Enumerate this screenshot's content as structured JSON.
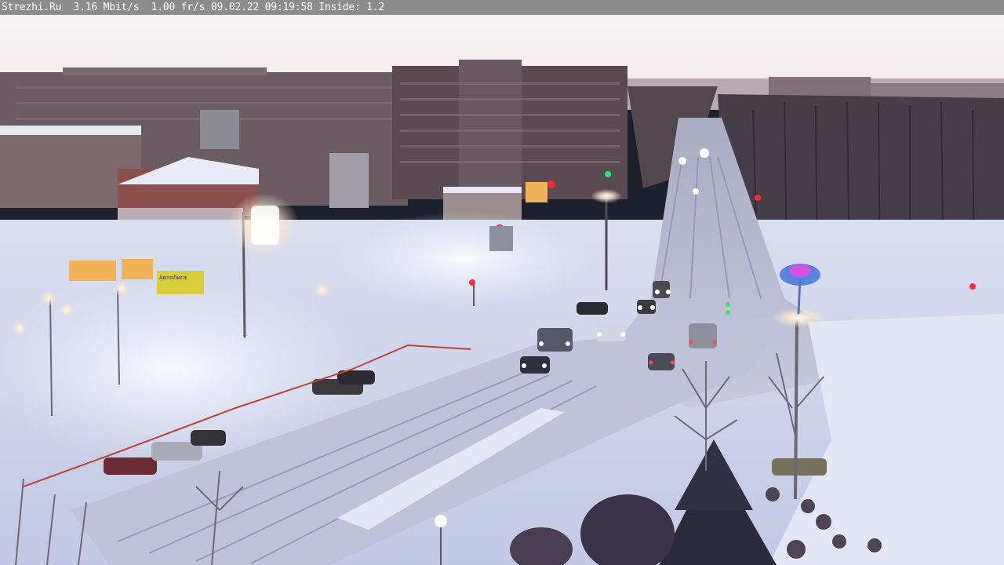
{
  "overlay": {
    "text": "Strezhi.Ru  3.16 Mbit/s  1.00 fr/s 09.02.22 09:19:58 Inside: 1.2"
  },
  "scene": {
    "description_colors": {
      "sky_top": "#f4f3f6",
      "sky_horizon": "#f6d9d9",
      "snow": "#dfe4f4",
      "snow_shadow": "#aeb5d3",
      "road": "#c9cbe2",
      "buildings": "#5a4a55",
      "trees": "#3f3a45"
    }
  },
  "signs": {
    "store_sign": "АвтоЛига"
  }
}
